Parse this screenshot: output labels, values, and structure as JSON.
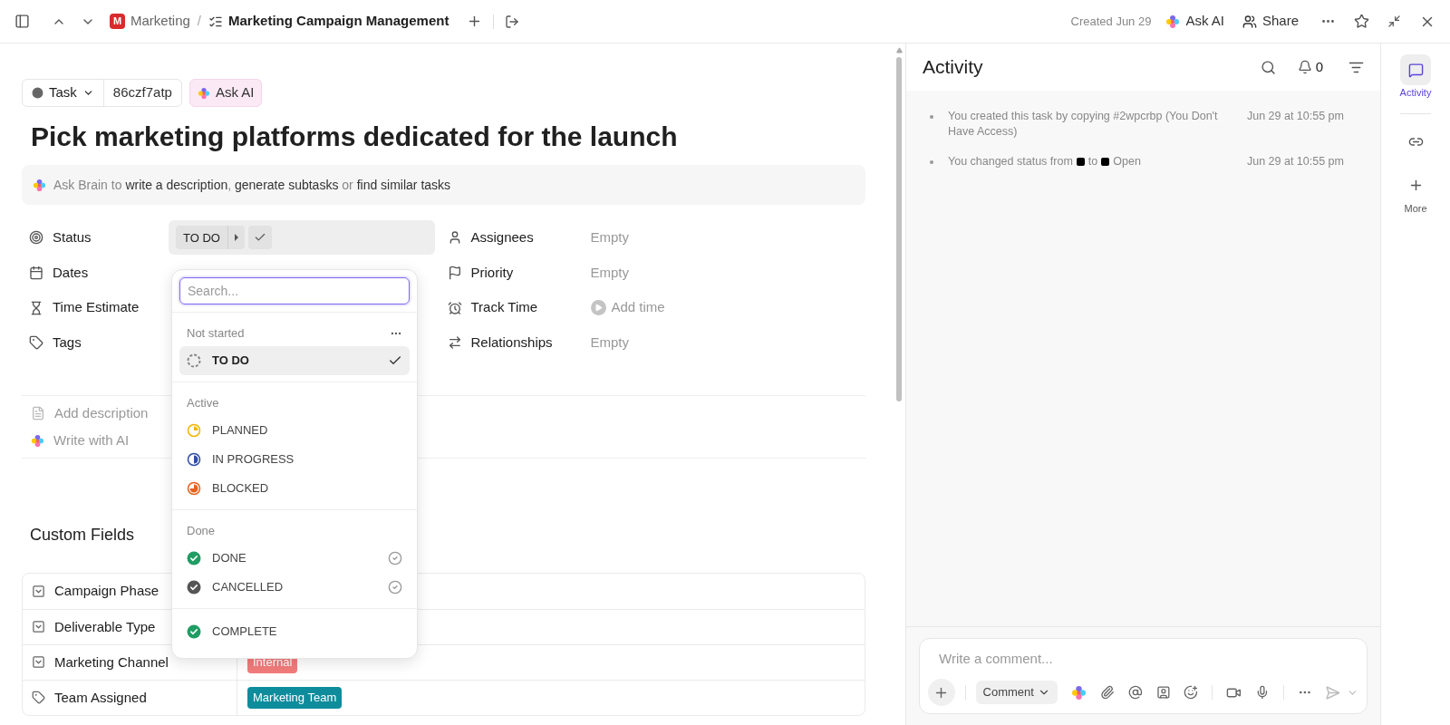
{
  "header": {
    "breadcrumb": [
      {
        "text": "Marketing",
        "kind": "space",
        "logo_letter": "M"
      },
      {
        "text": "Marketing Campaign Management",
        "kind": "list",
        "separator": "/"
      }
    ],
    "created": "Created Jun 29",
    "ask_ai": "Ask AI",
    "share": "Share"
  },
  "task": {
    "type": "Task",
    "id": "86czf7atp",
    "ask_ai": "Ask AI",
    "title": "Pick marketing platforms dedicated for the launch",
    "brain": "Ask Brain to **write a description**, **generate subtasks** or **find similar tasks**"
  },
  "fields_left": [
    {
      "label": "Status",
      "kind": "status",
      "value": "TO DO"
    },
    {
      "label": "Dates",
      "kind": "dates"
    },
    {
      "label": "Time Estimate",
      "kind": "time"
    },
    {
      "label": "Tags",
      "kind": "tags"
    }
  ],
  "fields_right": [
    {
      "label": "Assignees",
      "kind": "assignees",
      "value": "Empty"
    },
    {
      "label": "Priority",
      "kind": "priority",
      "value": "Empty"
    },
    {
      "label": "Track Time",
      "kind": "track",
      "value": "Add time"
    },
    {
      "label": "Relationships",
      "kind": "relationships",
      "value": "Empty"
    }
  ],
  "description_actions": [
    {
      "label": "Add description",
      "kind": "doc"
    },
    {
      "label": "Write with AI",
      "kind": "ai"
    }
  ],
  "custom_fields": {
    "title": "Custom Fields",
    "rows": [
      {
        "label": "Campaign Phase",
        "kind": "dropdown"
      },
      {
        "label": "Deliverable Type",
        "kind": "dropdown"
      },
      {
        "label": "Marketing Channel",
        "kind": "dropdown",
        "tag": "Internal",
        "color": "#f27b7b"
      },
      {
        "label": "Team Assigned",
        "kind": "label",
        "tag": "Marketing Team",
        "color": "#0e8c9c"
      }
    ]
  },
  "status_menu": {
    "placeholder": "Search...",
    "groups": [
      {
        "label": "Not started",
        "has_menu": true,
        "options": [
          {
            "label": "TO DO",
            "kind": "todo",
            "color": "#888888",
            "selected": true,
            "default_mark": false
          }
        ]
      },
      {
        "label": "Active",
        "has_menu": false,
        "options": [
          {
            "label": "PLANNED",
            "kind": "planned",
            "color": "#f4b400",
            "selected": false,
            "default_mark": false
          },
          {
            "label": "IN PROGRESS",
            "kind": "progress",
            "color": "#2e4da3",
            "selected": false,
            "default_mark": false
          },
          {
            "label": "BLOCKED",
            "kind": "blocked",
            "color": "#e8611a",
            "selected": false,
            "default_mark": false
          }
        ]
      },
      {
        "label": "Done",
        "has_menu": false,
        "options": [
          {
            "label": "DONE",
            "kind": "done",
            "color": "#1f9d63",
            "selected": false,
            "default_mark": true
          },
          {
            "label": "CANCELLED",
            "kind": "done",
            "color": "#555555",
            "selected": false,
            "default_mark": true
          }
        ]
      },
      {
        "options": [
          {
            "label": "COMPLETE",
            "kind": "done",
            "color": "#1f9d63",
            "selected": false,
            "default_mark": false
          }
        ]
      }
    ]
  },
  "activity": {
    "title": "Activity",
    "notifications": "0",
    "items": [
      {
        "segments": [
          {
            "text": "You created this task by copying #2wpcrbp (You Don't Have Access)"
          }
        ],
        "time": "Jun 29 at 10:55 pm"
      },
      {
        "segments": [
          {
            "text": "You changed status from"
          },
          {
            "color": "#000000"
          },
          {
            "text": "to"
          },
          {
            "color": "#000000"
          },
          {
            "text": "Open"
          }
        ],
        "time": "Jun 29 at 10:55 pm"
      }
    ],
    "comment_placeholder": "Write a comment...",
    "comment_type": "Comment"
  },
  "rail": [
    {
      "label": "Activity",
      "kind": "activity",
      "selected": true
    },
    {
      "kind": "link",
      "selected": false
    },
    {
      "label": "More",
      "kind": "more",
      "selected": false
    }
  ]
}
